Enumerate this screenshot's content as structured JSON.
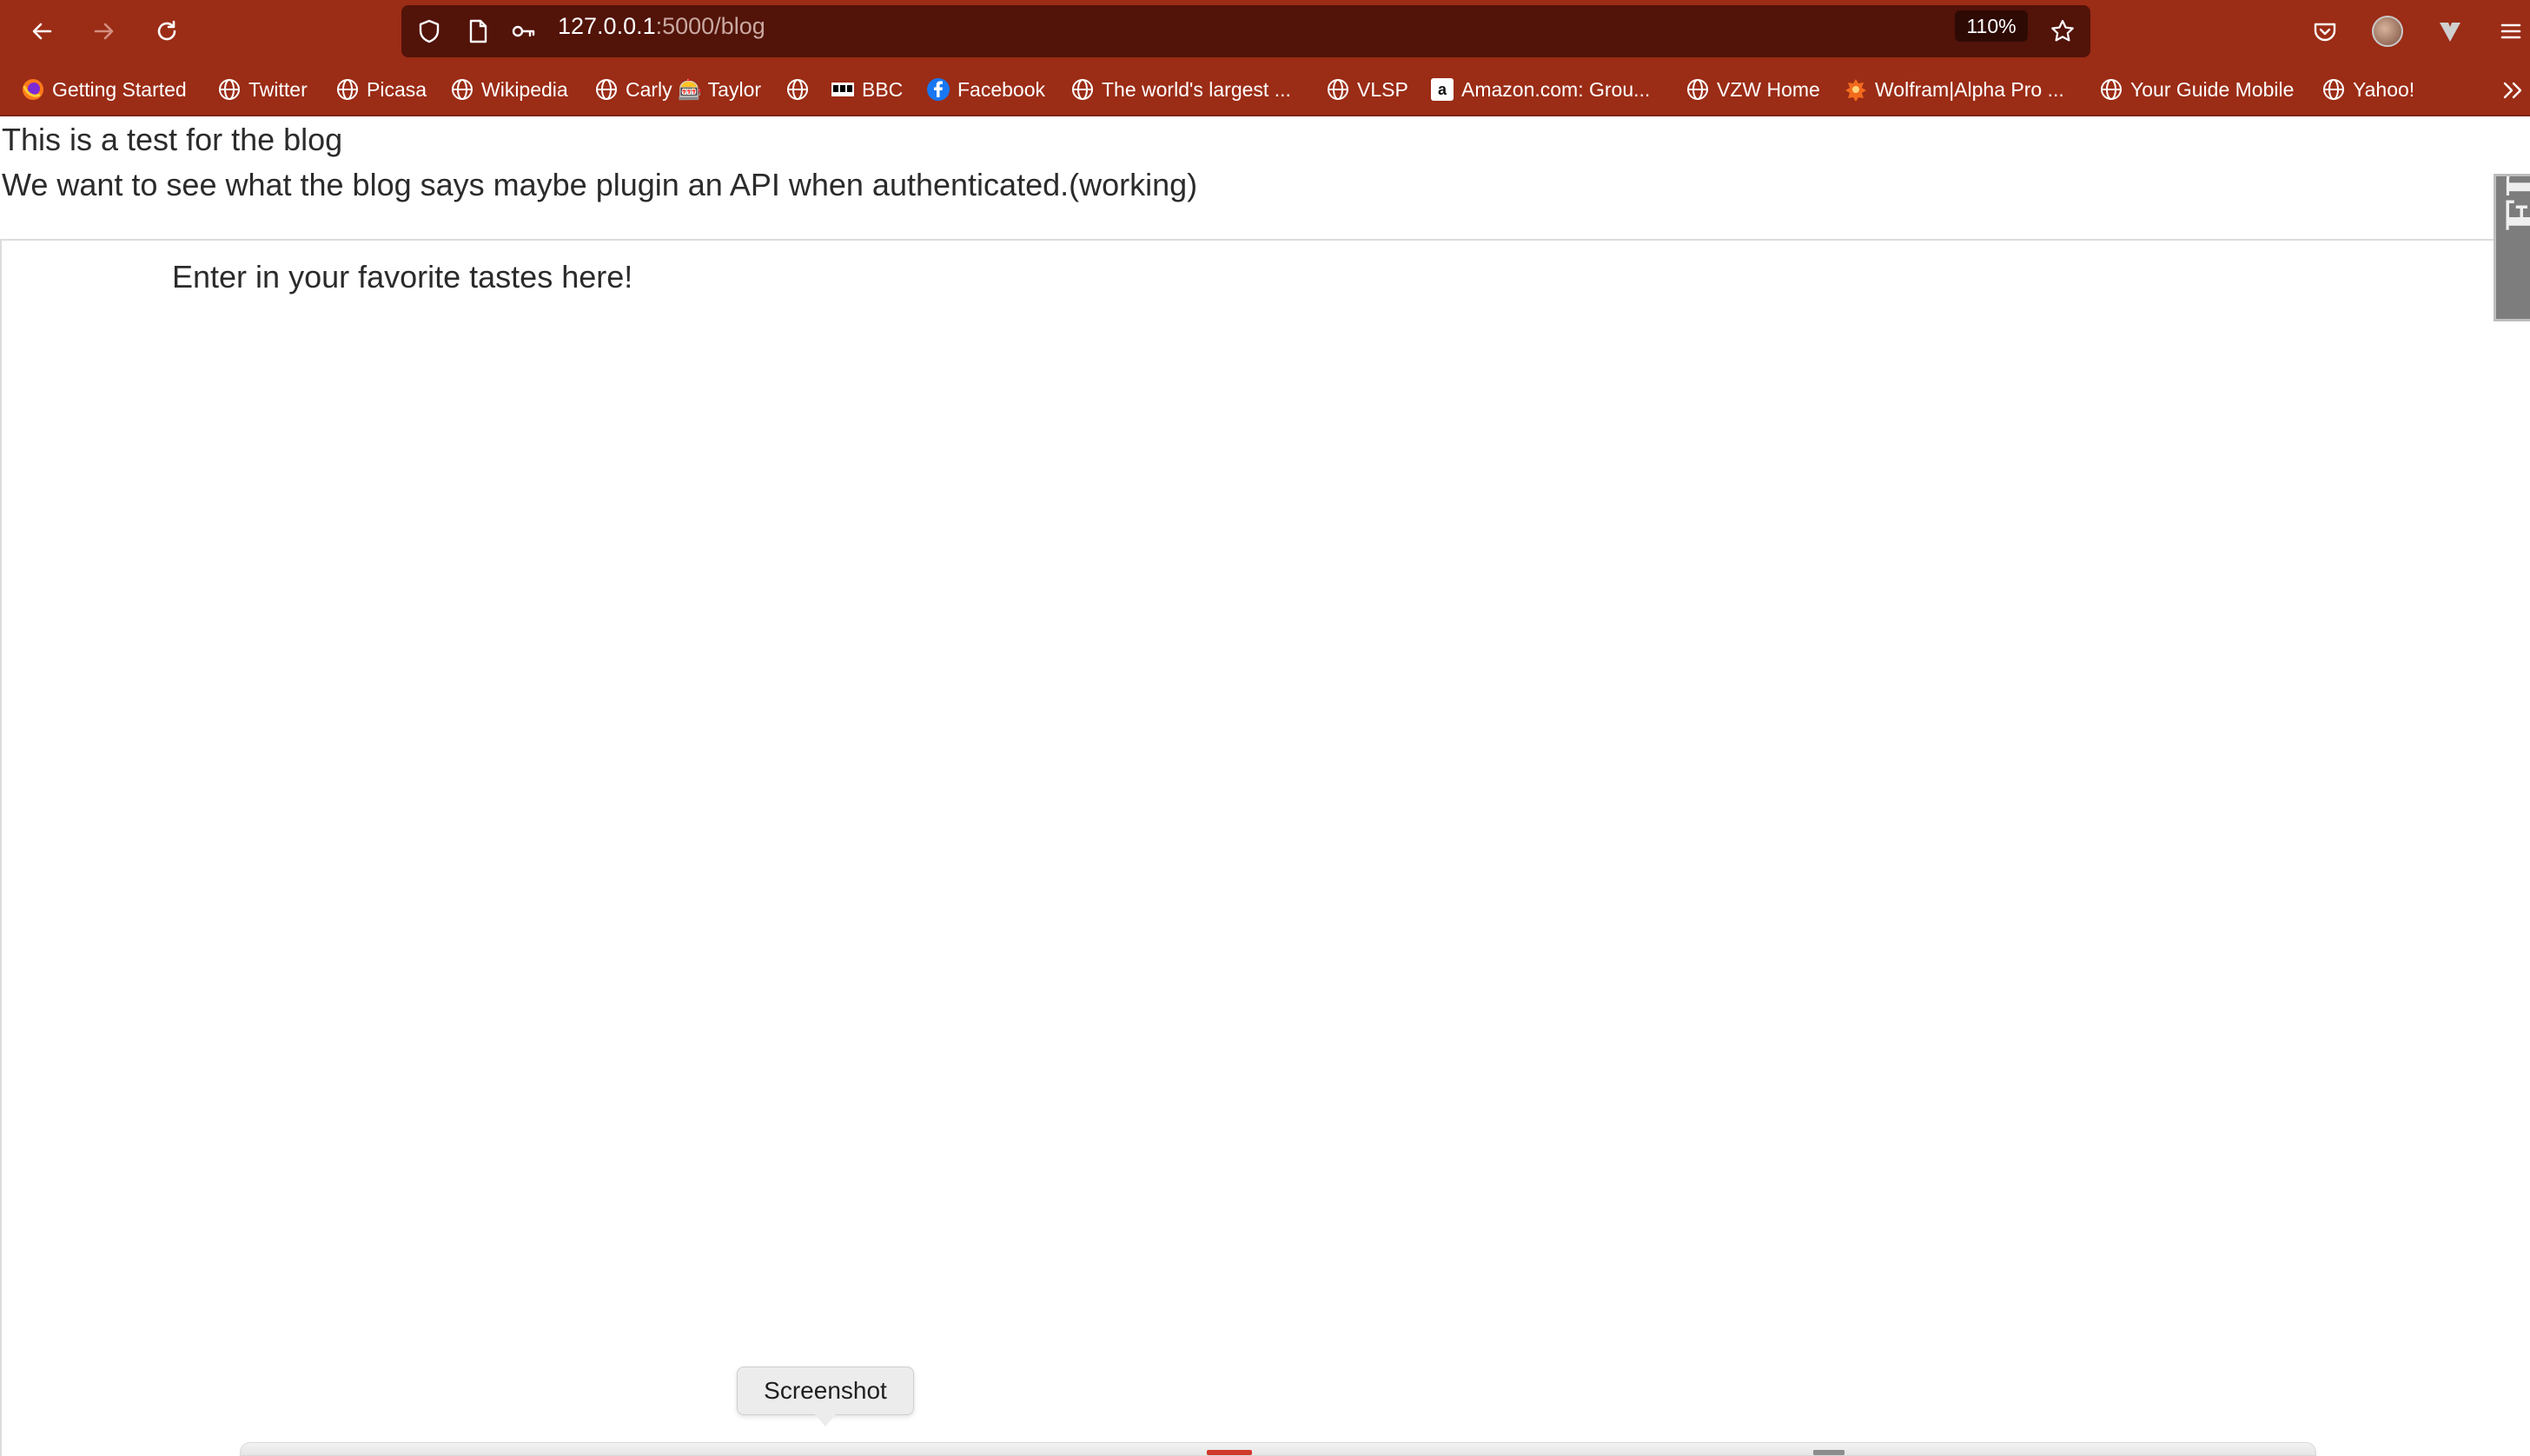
{
  "browser": {
    "url_host": "127.0.0.1",
    "url_path": ":5000/blog",
    "zoom": "110%",
    "colors": {
      "toolbar": "#9b2c16",
      "urlbar": "#521309"
    }
  },
  "bookmarks": [
    {
      "label": "Getting Started",
      "icon": "firefox-icon"
    },
    {
      "label": "Twitter",
      "icon": "globe-icon"
    },
    {
      "label": "Picasa",
      "icon": "globe-icon"
    },
    {
      "label": "Wikipedia",
      "icon": "globe-icon"
    },
    {
      "label": "Carly 🎰 Taylor",
      "icon": "globe-icon"
    },
    {
      "label": "",
      "icon": "globe-icon"
    },
    {
      "label": "BBC",
      "icon": "bbc-icon"
    },
    {
      "label": "Facebook",
      "icon": "facebook-icon"
    },
    {
      "label": "The world's largest ...",
      "icon": "globe-icon"
    },
    {
      "label": "VLSP",
      "icon": "globe-icon"
    },
    {
      "label": "Amazon.com: Grou...",
      "icon": "amazon-icon"
    },
    {
      "label": "VZW Home",
      "icon": "globe-icon"
    },
    {
      "label": "Wolfram|Alpha Pro ...",
      "icon": "wolfram-icon"
    },
    {
      "label": "Your Guide Mobile",
      "icon": "globe-icon"
    },
    {
      "label": "Yahoo!",
      "icon": "globe-icon"
    }
  ],
  "page": {
    "line1": "This is a test for the blog",
    "line2": "We want to see what the blog says maybe plugin an API when authenticated.(working)",
    "frame_prompt": "Enter in your favorite tastes here!"
  },
  "tooltip": {
    "label": "Screenshot"
  }
}
